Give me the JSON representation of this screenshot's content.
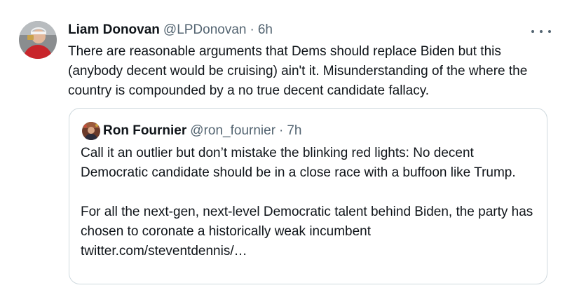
{
  "tweet": {
    "author_name": "Liam Donovan",
    "author_handle": "@LPDonovan",
    "separator": "·",
    "time": "6h",
    "text": "There are reasonable arguments that Dems should replace Biden but this (anybody decent would be cruising) ain't it. Misunderstanding of the where the country is compounded by a no true decent candidate fallacy.",
    "more_icon": "more-horizontal-icon"
  },
  "quoted_tweet": {
    "author_name": "Ron Fournier",
    "author_handle": "@ron_fournier",
    "separator": "·",
    "time": "7h",
    "paragraph_1": "Call it an outlier but don’t mistake the blinking red lights: No decent Democratic candidate should be in a close race with a buffoon like Trump.",
    "paragraph_2": "For all the next-gen, next-level Democratic talent behind Biden, the party has chosen to coronate a historically weak incumbent twitter.com/steventdennis/…"
  },
  "colors": {
    "text": "#0f1419",
    "secondary": "#536471",
    "border": "#cfd9de"
  }
}
